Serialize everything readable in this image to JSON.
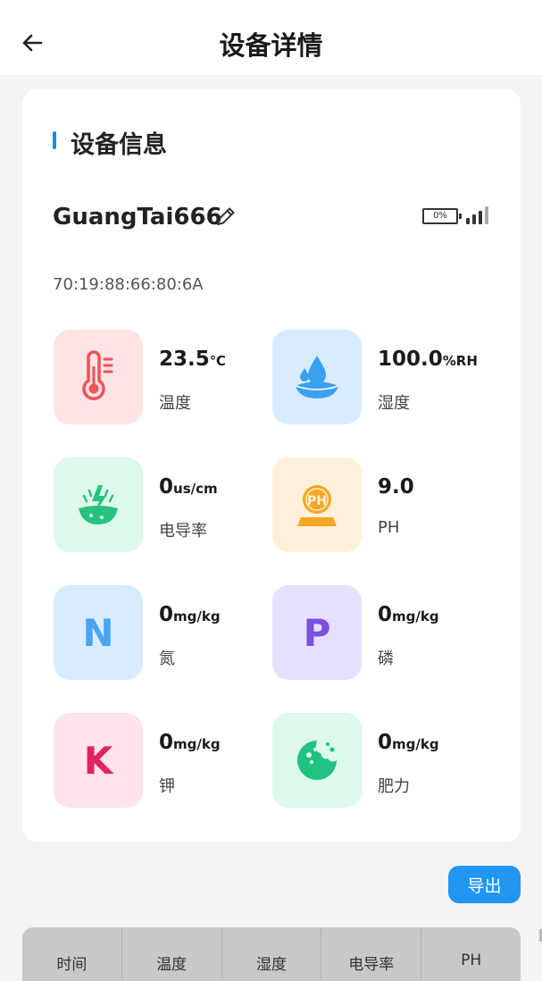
{
  "header": {
    "title": "设备详情",
    "back_icon": "arrow-left-icon"
  },
  "card": {
    "section_title": "设备信息",
    "accent_color": "#1e88e5",
    "device_name": "GuangTai666",
    "battery_text": "0%",
    "mac": "70:19:88:66:80:6A"
  },
  "metrics": [
    {
      "key": "temperature",
      "value": "23.5",
      "unit": "℃",
      "label": "温度",
      "icon": "thermometer-icon",
      "tile_color": "#ffe4e4",
      "icon_color": "#f0525a"
    },
    {
      "key": "humidity",
      "value": "100.0",
      "unit": "%RH",
      "label": "湿度",
      "icon": "water-drop-icon",
      "tile_color": "#d9ecff",
      "icon_color": "#3aa0f0"
    },
    {
      "key": "conductivity",
      "value": "0",
      "unit": "us/cm",
      "label": "电导率",
      "icon": "soil-electric-icon",
      "tile_color": "#dcf9ea",
      "icon_color": "#27c37e"
    },
    {
      "key": "ph",
      "value": "9.0",
      "unit": "",
      "label": "PH",
      "icon": "ph-meter-icon",
      "tile_color": "#fff1d9",
      "icon_color": "#f5a623"
    },
    {
      "key": "nitrogen",
      "value": "0",
      "unit": "mg/kg",
      "label": "氮",
      "icon": "nitrogen-n-icon",
      "tile_color": "#d9ecff",
      "icon_color": "#4aa3f5"
    },
    {
      "key": "phosphorus",
      "value": "0",
      "unit": "mg/kg",
      "label": "磷",
      "icon": "phosphorus-p-icon",
      "tile_color": "#e6e0ff",
      "icon_color": "#7a4fe0"
    },
    {
      "key": "potassium",
      "value": "0",
      "unit": "mg/kg",
      "label": "钾",
      "icon": "potassium-k-icon",
      "tile_color": "#ffe4ec",
      "icon_color": "#e0245e"
    },
    {
      "key": "fertility",
      "value": "0",
      "unit": "mg/kg",
      "label": "肥力",
      "icon": "fertility-icon",
      "tile_color": "#dcf9ea",
      "icon_color": "#20c27f"
    }
  ],
  "export_button": {
    "label": "导出",
    "color": "#2196f3"
  },
  "table": {
    "headers": [
      "时间",
      "温度",
      "湿度",
      "电导率",
      "PH"
    ]
  }
}
